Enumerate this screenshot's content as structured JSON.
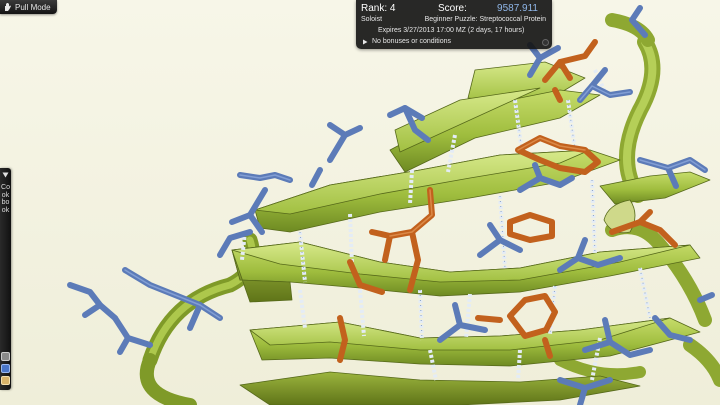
{
  "toolbar": {
    "mode_label": "Pull Mode",
    "mode_icon": "hand-icon"
  },
  "score_panel": {
    "rank_label": "Rank: 4",
    "score_label": "Score:",
    "score_value": "9587.911",
    "player_group": "Soloist",
    "puzzle_title": "Beginner Puzzle: Streptococcal Protein",
    "expires": "Expires 3/27/2013 17:00 MZ (2 days, 17 hours)",
    "bonus_text": "No bonuses or conditions"
  },
  "cookbook": {
    "label": "Cookbook",
    "toggle_icon": "triangle-down-icon"
  },
  "colors": {
    "background": "#f4f3e3",
    "sheet": "#a8c84a",
    "sidechain_hydrophobic": "#c9651f",
    "sidechain_hydrophilic": "#5f7cb8",
    "hydrogen_bond": "#dfe8f4",
    "score_value": "#8fb6e8"
  }
}
